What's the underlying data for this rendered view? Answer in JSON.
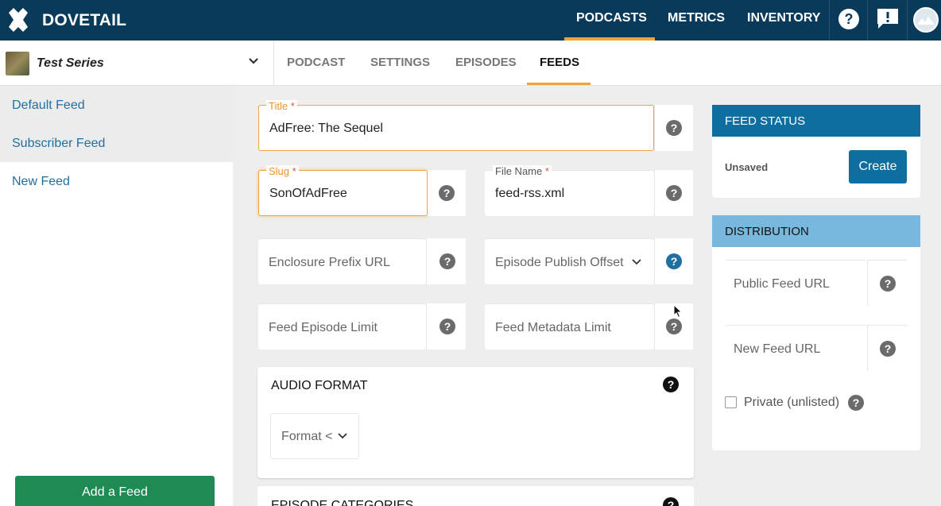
{
  "header": {
    "brand": "DOVETAIL",
    "nav": [
      {
        "label": "PODCASTS",
        "active": true
      },
      {
        "label": "METRICS",
        "active": false
      },
      {
        "label": "INVENTORY",
        "active": false
      }
    ]
  },
  "series": {
    "name": "Test Series"
  },
  "tabs": [
    {
      "label": "PODCAST"
    },
    {
      "label": "SETTINGS"
    },
    {
      "label": "EPISODES"
    },
    {
      "label": "FEEDS",
      "active": true
    }
  ],
  "sidebar": {
    "items": [
      {
        "label": "Default Feed",
        "selected": true
      },
      {
        "label": "Subscriber Feed",
        "selected": true
      },
      {
        "label": "New Feed",
        "selected": false
      }
    ],
    "add_button": "Add a Feed"
  },
  "form": {
    "title": {
      "label": "Title",
      "required": "*",
      "value": "AdFree: The Sequel"
    },
    "slug": {
      "label": "Slug",
      "required": "*",
      "value": "SonOfAdFree"
    },
    "file_name": {
      "label": "File Name",
      "required": "*",
      "value": "feed-rss.xml"
    },
    "enclosure_prefix": {
      "placeholder": "Enclosure Prefix URL"
    },
    "publish_offset": {
      "placeholder": "Episode Publish Offset"
    },
    "episode_limit": {
      "placeholder": "Feed Episode Limit"
    },
    "metadata_limit": {
      "placeholder": "Feed Metadata Limit"
    },
    "audio_format": {
      "title": "AUDIO FORMAT",
      "format_label": "Format <"
    },
    "episode_categories": {
      "title": "EPISODE CATEGORIES"
    }
  },
  "feed_status": {
    "title": "FEED STATUS",
    "status": "Unsaved",
    "create_button": "Create"
  },
  "distribution": {
    "title": "DISTRIBUTION",
    "public_url_placeholder": "Public Feed URL",
    "new_url_placeholder": "New Feed URL",
    "private_label": "Private (unlisted)",
    "private_checked": false
  },
  "help_glyph": "?",
  "colors": {
    "topbar": "#0a3a5a",
    "accent": "#f1a33a",
    "link": "#1f6fa0",
    "primary_button": "#0f6ea0",
    "add_button": "#208a55",
    "distribution_header": "#79b8de"
  }
}
